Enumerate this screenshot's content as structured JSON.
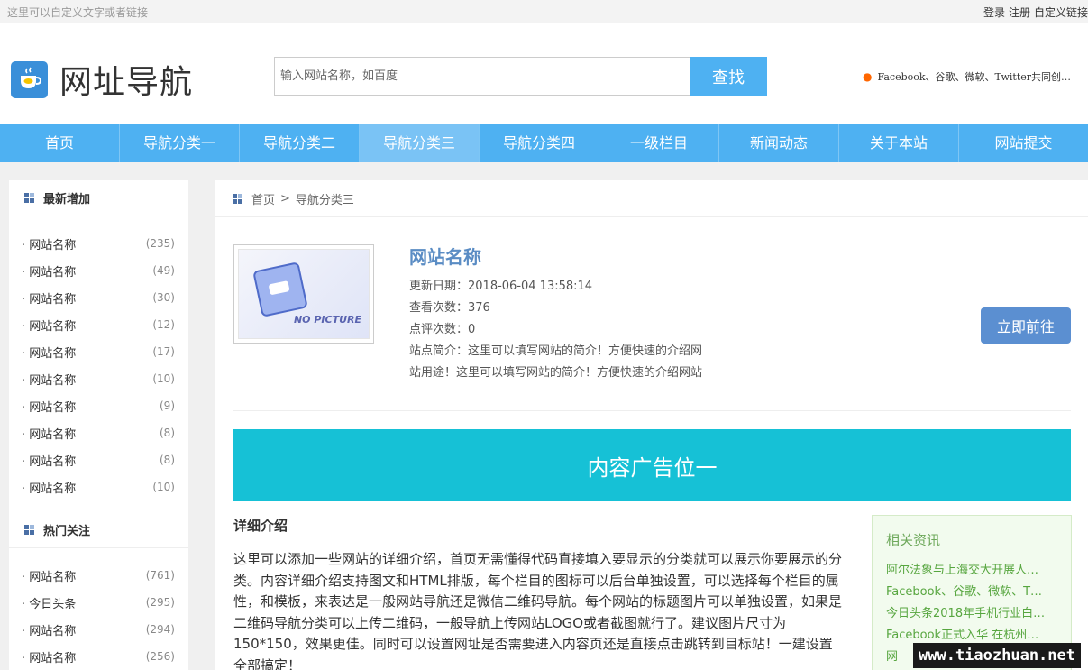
{
  "topbar": {
    "left_text": "这里可以自定义文字或者链接",
    "links": [
      "登录",
      "注册",
      "自定义链接"
    ]
  },
  "header": {
    "logo_text": "网址导航",
    "search_placeholder": "输入网站名称，如百度",
    "search_button": "查找",
    "news_tip": "Facebook、谷歌、微软、Twitter共同创…"
  },
  "nav": {
    "items": [
      "首页",
      "导航分类一",
      "导航分类二",
      "导航分类三",
      "导航分类四",
      "一级栏目",
      "新闻动态",
      "关于本站",
      "网站提交"
    ],
    "active_index": 3
  },
  "sidebar": {
    "newest_title": "最新增加",
    "newest": [
      {
        "name": "网站名称",
        "count": "(235)"
      },
      {
        "name": "网站名称",
        "count": "(49)"
      },
      {
        "name": "网站名称",
        "count": "(30)"
      },
      {
        "name": "网站名称",
        "count": "(12)"
      },
      {
        "name": "网站名称",
        "count": "(17)"
      },
      {
        "name": "网站名称",
        "count": "(10)"
      },
      {
        "name": "网站名称",
        "count": "(9)"
      },
      {
        "name": "网站名称",
        "count": "(8)"
      },
      {
        "name": "网站名称",
        "count": "(8)"
      },
      {
        "name": "网站名称",
        "count": "(10)"
      }
    ],
    "hot_title": "热门关注",
    "hot": [
      {
        "name": "网站名称",
        "count": "(761)"
      },
      {
        "name": "今日头条",
        "count": "(295)"
      },
      {
        "name": "网站名称",
        "count": "(294)"
      },
      {
        "name": "网站名称",
        "count": "(256)"
      }
    ]
  },
  "breadcrumb": {
    "home": "首页",
    "sep": ">",
    "current": "导航分类三"
  },
  "site": {
    "thumb_label": "NO PICTURE",
    "title": "网站名称",
    "update_date": "更新日期：2018-06-04 13:58:14",
    "views": "查看次数：376",
    "comments": "点评次数：0",
    "intro": "站点简介：这里可以填写网站的简介！方便快速的介绍网",
    "usage": "站用途！这里可以填写网站的简介！方便快速的介绍网站",
    "go_button": "立即前往"
  },
  "ad": {
    "text": "内容广告位一"
  },
  "detail": {
    "title": "详细介绍",
    "body": "这里可以添加一些网站的详细介绍，首页无需懂得代码直接填入要显示的分类就可以展示你要展示的分类。内容详细介绍支持图文和HTML排版，每个栏目的图标可以后台单独设置，可以选择每个栏目的属性，和模板，来表达是一般网站导航还是微信二维码导航。每个网站的标题图片可以单独设置，如果是二维码导航分类可以上传二维码，一般导航上传网站LOGO或者截图就行了。建议图片尺寸为150*150，效果更佳。同时可以设置网址是否需要进入内容页还是直接点击跳转到目标站！一建设置全部搞定！"
  },
  "related": {
    "title": "相关资讯",
    "items": [
      "阿尔法象与上海交大开展人…",
      "Facebook、谷歌、微软、T…",
      "今日头条2018年手机行业白…",
      "Facebook正式入华 在杭州…",
      "网"
    ]
  },
  "watermark": "www.tiaozhuan.net"
}
